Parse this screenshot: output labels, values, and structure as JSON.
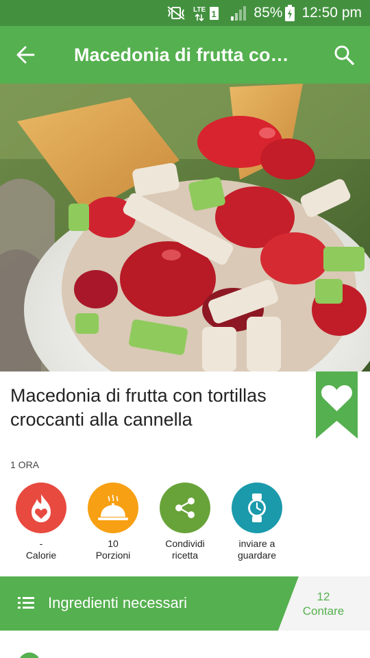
{
  "status_bar": {
    "network": "LTE",
    "sim": "1",
    "battery": "85%",
    "time": "12:50 pm"
  },
  "app_bar": {
    "title": "Macedonia di frutta co…",
    "icons": [
      "back-arrow-icon",
      "search-icon"
    ]
  },
  "recipe": {
    "title": "Macedonia di frutta con tortillas croccanti alla cannella",
    "time": "1 ORA"
  },
  "actions": [
    {
      "icon": "calorie-flame-icon",
      "value": "-",
      "label": "Calorie",
      "color": "#e84a3f"
    },
    {
      "icon": "serving-cloche-icon",
      "value": "10",
      "label": "Porzioni",
      "color": "#f7a013"
    },
    {
      "icon": "share-icon",
      "value": "",
      "label": "Condividi ricetta",
      "color": "#68a339"
    },
    {
      "icon": "watch-icon",
      "value": "",
      "label": "inviare a guardare",
      "color": "#1a9aab"
    }
  ],
  "ingredients": {
    "label": "Ingredienti necessari",
    "count": "12",
    "count_label": "Contare"
  },
  "colors": {
    "primary": "#55b04f",
    "status_bar": "#43913f",
    "bookmark": "#55b04f"
  }
}
